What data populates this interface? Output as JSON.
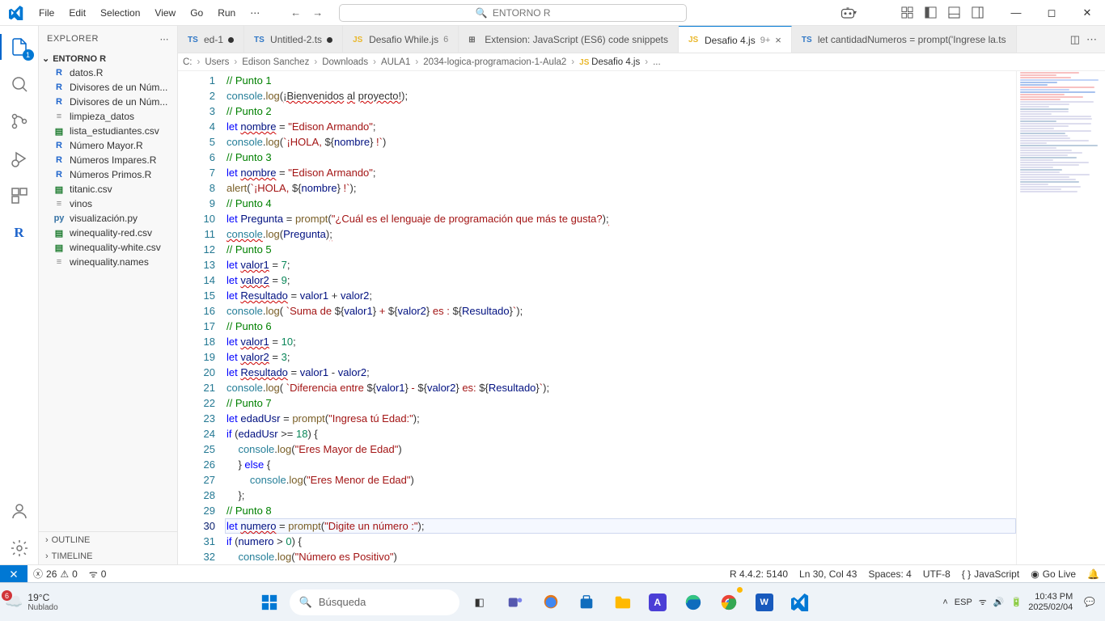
{
  "menu": {
    "file": "File",
    "edit": "Edit",
    "selection": "Selection",
    "view": "View",
    "go": "Go",
    "run": "Run",
    "more": "⋯"
  },
  "search_center": "ENTORNO R",
  "explorer": {
    "title": "EXPLORER",
    "root": "ENTORNO R",
    "files": [
      {
        "icon": "R",
        "color": "#1f65cc",
        "name": "datos.R"
      },
      {
        "icon": "R",
        "color": "#1f65cc",
        "name": "Divisores de un Núm..."
      },
      {
        "icon": "R",
        "color": "#1f65cc",
        "name": "Divisores de un Núm..."
      },
      {
        "icon": "≡",
        "color": "#888",
        "name": "limpieza_datos"
      },
      {
        "icon": "▤",
        "color": "#1b7a2d",
        "name": "lista_estudiantes.csv"
      },
      {
        "icon": "R",
        "color": "#1f65cc",
        "name": "Número Mayor.R"
      },
      {
        "icon": "R",
        "color": "#1f65cc",
        "name": "Números Impares.R"
      },
      {
        "icon": "R",
        "color": "#1f65cc",
        "name": "Números Primos.R"
      },
      {
        "icon": "▤",
        "color": "#1b7a2d",
        "name": "titanic.csv"
      },
      {
        "icon": "≡",
        "color": "#888",
        "name": "vinos"
      },
      {
        "icon": "py",
        "color": "#3572a5",
        "name": "visualización.py"
      },
      {
        "icon": "▤",
        "color": "#1b7a2d",
        "name": "winequality-red.csv"
      },
      {
        "icon": "▤",
        "color": "#1b7a2d",
        "name": "winequality-white.csv"
      },
      {
        "icon": "≡",
        "color": "#888",
        "name": "winequality.names"
      }
    ],
    "outline": "OUTLINE",
    "timeline": "TIMELINE"
  },
  "tabs": [
    {
      "icon": "TS",
      "color": "#3178c6",
      "label": "ed-1",
      "mod": true,
      "trunc": true
    },
    {
      "icon": "TS",
      "color": "#3178c6",
      "label": "Untitled-2.ts",
      "mod": true
    },
    {
      "icon": "JS",
      "color": "#e9b72b",
      "label": "Desafio While.js",
      "suffix": "6"
    },
    {
      "icon": "⊞",
      "color": "#666",
      "label": "Extension: JavaScript (ES6) code snippets"
    },
    {
      "icon": "JS",
      "color": "#e9b72b",
      "label": "Desafio 4.js",
      "suffix": "9+",
      "active": true,
      "close": true
    },
    {
      "icon": "TS",
      "color": "#3178c6",
      "label": "let cantidadNumeros = prompt('Ingrese la.ts"
    }
  ],
  "breadcrumb": [
    "C:",
    "Users",
    "Edison Sanchez",
    "Downloads",
    "AULA1",
    "2034-logica-programacion-1-Aula2",
    "Desafio 4.js",
    "..."
  ],
  "code": [
    {
      "n": 1,
      "t": "comment",
      "s": "// Punto 1"
    },
    {
      "n": 2,
      "html": "<span class='obj'>console</span>.<span class='fn'>log</span>(<span class='warn'>¡Bienvenidos</span> <span class='warn'>al</span> <span class='warn'>proyecto!</span>);"
    },
    {
      "n": 3,
      "t": "comment",
      "s": "// Punto 2"
    },
    {
      "n": 4,
      "html": "<span class='kw'>let</span> <span class='var warn'>nombre</span> = <span class='str'>\"Edison Armando\"</span>;"
    },
    {
      "n": 5,
      "html": "<span class='obj'>console</span>.<span class='fn'>log</span>(<span class='str'>`¡HOLA, </span>${<span class='var'>nombre</span>}<span class='str'> !`</span>)"
    },
    {
      "n": 6,
      "t": "comment",
      "s": "// Punto 3"
    },
    {
      "n": 7,
      "html": "<span class='kw'>let</span> <span class='var warn'>nombre</span> = <span class='str'>\"Edison Armando\"</span>;"
    },
    {
      "n": 8,
      "html": "<span class='fn'>alert</span>(<span class='str'>`¡HOLA, </span>${<span class='var'>nombre</span>}<span class='str'> !`</span>);"
    },
    {
      "n": 9,
      "t": "comment",
      "s": "// Punto 4"
    },
    {
      "n": 10,
      "html": "<span class='kw'>let</span> <span class='var'>Pregunta</span> = <span class='fn'>prompt</span>(<span class='str'>\"¿Cuál es el lenguaje de programación que más te gusta?</span>)<span class='warn'>;</span>"
    },
    {
      "n": 11,
      "html": "<span class='obj warn'>console</span>.<span class='fn'>log</span>(<span class='var'>Pregunta</span>)<span class='warn'>;</span>"
    },
    {
      "n": 12,
      "t": "comment",
      "s": "// Punto 5"
    },
    {
      "n": 13,
      "html": "<span class='kw'>let</span> <span class='var warn'>valor1</span> = <span class='num'>7</span>;"
    },
    {
      "n": 14,
      "html": "<span class='kw'>let</span> <span class='var warn'>valor2</span> = <span class='num'>9</span>;"
    },
    {
      "n": 15,
      "html": "<span class='kw'>let</span> <span class='var warn'>Resultado</span> = <span class='var'>valor1</span> + <span class='var'>valor2</span>;"
    },
    {
      "n": 16,
      "html": "<span class='obj'>console</span>.<span class='fn'>log</span>( <span class='str'>`Suma de </span>${<span class='var'>valor1</span>}<span class='str'> + </span>${<span class='var'>valor2</span>}<span class='str'> es : </span>${<span class='var'>Resultado</span>}<span class='str'>`</span>);"
    },
    {
      "n": 17,
      "t": "comment",
      "s": "// Punto 6"
    },
    {
      "n": 18,
      "html": "<span class='kw'>let</span> <span class='var warn'>valor1</span> = <span class='num'>10</span>;"
    },
    {
      "n": 19,
      "html": "<span class='kw'>let</span> <span class='var warn'>valor2</span> = <span class='num'>3</span>;"
    },
    {
      "n": 20,
      "html": "<span class='kw'>let</span> <span class='var warn'>Resultado</span> = <span class='var'>valor1</span> - <span class='var'>valor2</span>;"
    },
    {
      "n": 21,
      "html": "<span class='obj'>console</span>.<span class='fn'>log</span>( <span class='str'>`Diferencia entre </span>${<span class='var'>valor1</span>}<span class='str'> - </span>${<span class='var'>valor2</span>}<span class='str'> es: </span>${<span class='var'>Resultado</span>}<span class='str'>`</span>);"
    },
    {
      "n": 22,
      "t": "comment",
      "s": "// Punto 7"
    },
    {
      "n": 23,
      "html": "<span class='kw'>let</span> <span class='var'>edadUsr</span> = <span class='fn'>prompt</span>(<span class='str'>\"Ingresa tú Edad:\"</span>);"
    },
    {
      "n": 24,
      "html": "<span class='kw'>if</span> (<span class='var'>edadUsr</span> &gt;= <span class='num'>18</span>) {"
    },
    {
      "n": 25,
      "html": "    <span class='obj'>console</span>.<span class='fn'>log</span>(<span class='str'>\"Eres Mayor de Edad\"</span>)"
    },
    {
      "n": 26,
      "html": "    } <span class='kw'>else</span> {"
    },
    {
      "n": 27,
      "html": "        <span class='obj'>console</span>.<span class='fn'>log</span>(<span class='str'>\"Eres Menor de Edad\"</span>)"
    },
    {
      "n": 28,
      "html": "    };"
    },
    {
      "n": 29,
      "t": "comment",
      "s": "// Punto 8"
    },
    {
      "n": 30,
      "hl": true,
      "html": "<span class='kw'>let</span> <span class='var warn'>numero</span> = <span class='fn'>prompt</span>(<span class='str'>\"Digite un número :\"</span>);"
    },
    {
      "n": 31,
      "html": "<span class='kw'>if</span> (<span class='var'>numero</span> &gt; <span class='num'>0</span>) {"
    },
    {
      "n": 32,
      "html": "    <span class='obj'>console</span>.<span class='fn'>log</span>(<span class='str'>\"Número es Positivo\"</span>)"
    }
  ],
  "status": {
    "errors": "26",
    "warnings": "0",
    "radio": "0",
    "rver": "R 4.4.2: 5140",
    "pos": "Ln 30, Col 43",
    "spaces": "Spaces: 4",
    "enc": "UTF-8",
    "lang": "JavaScript",
    "golive": "Go Live"
  },
  "taskbar": {
    "temp": "19°C",
    "cond": "Nublado",
    "badge": "6",
    "search": "Búsqueda",
    "lang": "ESP",
    "time": "10:43 PM",
    "date": "2025/02/04"
  }
}
